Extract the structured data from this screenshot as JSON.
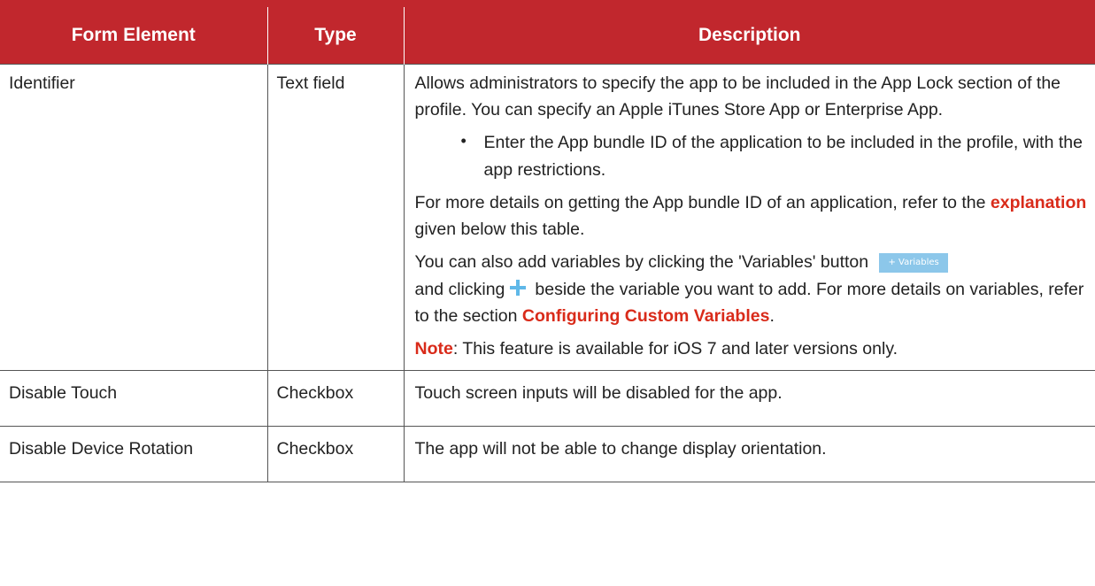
{
  "table": {
    "headers": [
      "Form Element",
      "Type",
      "Description"
    ],
    "rows": [
      {
        "element": "Identifier",
        "type": "Text field",
        "desc": {
          "intro": "Allows administrators to specify the app to be included in the App Lock section of the profile. You can specify an Apple iTunes Store App or Enterprise App.",
          "bullet": "Enter the App bundle ID of the application to be included in the profile, with the app restrictions.",
          "details_before": "For more details on getting the App bundle ID of an application, refer to the ",
          "details_link": "explanation",
          "details_after": " given below this table.",
          "variables_before": "You can also add variables by clicking the 'Variables' button",
          "variables_button": "+ Variables",
          "variables_middle": "and clicking",
          "variables_after": "beside the variable you want to add. For more details on variables, refer to the section ",
          "variables_link": "Configuring Custom Variables",
          "variables_end": ".",
          "note_label": "Note",
          "note_text": ": This feature is available for iOS 7 and later versions only."
        }
      },
      {
        "element": "Disable Touch",
        "type": "Checkbox",
        "desc": "Touch screen inputs will be disabled for the app."
      },
      {
        "element": "Disable Device Rotation",
        "type": "Checkbox",
        "desc": "The app will not be able to change display orientation."
      }
    ]
  },
  "colors": {
    "header_bg": "#c1272d",
    "link_red": "#d92b1a",
    "variables_button_bg": "#8cc7ea",
    "plus_icon": "#5fb8e8"
  },
  "icons": [
    "bullet-icon",
    "plus-icon"
  ]
}
